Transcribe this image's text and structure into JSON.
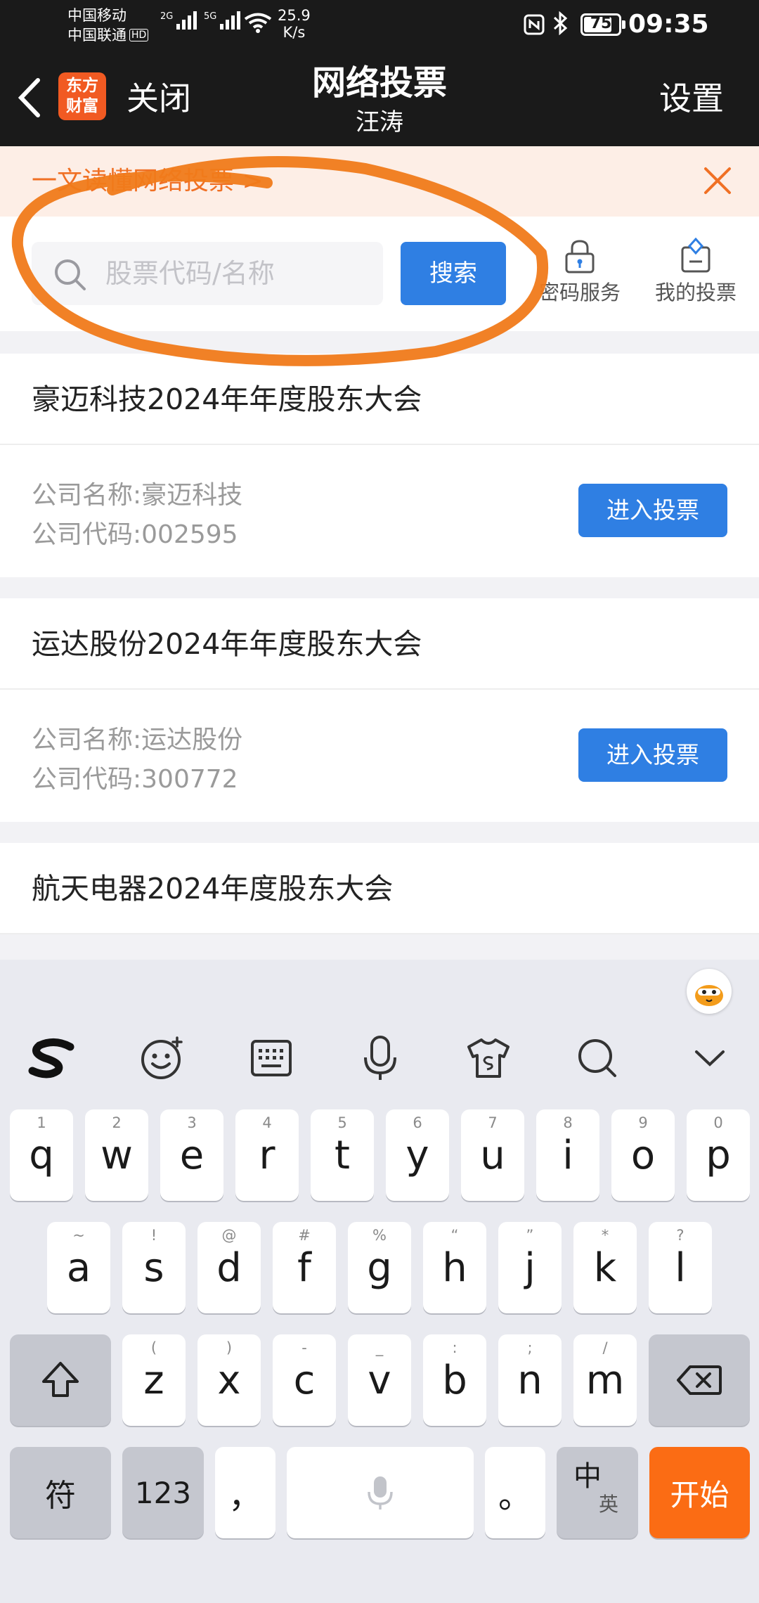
{
  "status_bar": {
    "carrier_1": "中国移动",
    "carrier_2": "中国联通",
    "hd_badge": "HD",
    "signal_1_label": "2G",
    "signal_2_label": "5G",
    "net_speed_value": "25.9",
    "net_speed_unit": "K/s",
    "battery_level": "75",
    "time": "09:35",
    "icons": [
      "nfc-icon",
      "bluetooth-icon",
      "wifi-icon",
      "battery-icon"
    ]
  },
  "header": {
    "back_icon": "chevron-left-icon",
    "app_logo_line1": "东方",
    "app_logo_line2": "财富",
    "close_label": "关闭",
    "title": "网络投票",
    "subtitle": "汪涛",
    "settings_label": "设置"
  },
  "banner": {
    "text": "一文读懂网络投票 >"
  },
  "search": {
    "placeholder": "股票代码/名称",
    "value": "",
    "button_label": "搜索"
  },
  "tools": [
    {
      "label": "密码服务",
      "icon": "lock-icon"
    },
    {
      "label": "我的投票",
      "icon": "my-vote-icon"
    }
  ],
  "votes": [
    {
      "title": "豪迈科技2024年年度股东大会",
      "company_name": "公司名称:豪迈科技",
      "company_code": "公司代码:002595",
      "button_label": "进入投票"
    },
    {
      "title": "运达股份2024年年度股东大会",
      "company_name": "公司名称:运达股份",
      "company_code": "公司代码:300772",
      "button_label": "进入投票"
    },
    {
      "title": "航天电器2024年度股东大会"
    }
  ],
  "keyboard": {
    "toolbar_icons": [
      "sogou-logo-icon",
      "emoji-icon",
      "keyboard-icon",
      "microphone-icon",
      "skin-icon",
      "search-icon",
      "collapse-icon"
    ],
    "row1": [
      {
        "hint": "1",
        "key": "q"
      },
      {
        "hint": "2",
        "key": "w"
      },
      {
        "hint": "3",
        "key": "e"
      },
      {
        "hint": "4",
        "key": "r"
      },
      {
        "hint": "5",
        "key": "t"
      },
      {
        "hint": "6",
        "key": "y"
      },
      {
        "hint": "7",
        "key": "u"
      },
      {
        "hint": "8",
        "key": "i"
      },
      {
        "hint": "9",
        "key": "o"
      },
      {
        "hint": "0",
        "key": "p"
      }
    ],
    "row2": [
      {
        "hint": "~",
        "key": "a"
      },
      {
        "hint": "!",
        "key": "s"
      },
      {
        "hint": "@",
        "key": "d"
      },
      {
        "hint": "#",
        "key": "f"
      },
      {
        "hint": "%",
        "key": "g"
      },
      {
        "hint": "“",
        "key": "h"
      },
      {
        "hint": "”",
        "key": "j"
      },
      {
        "hint": "*",
        "key": "k"
      },
      {
        "hint": "?",
        "key": "l"
      }
    ],
    "row3": [
      {
        "hint": "(",
        "key": "z"
      },
      {
        "hint": ")",
        "key": "x"
      },
      {
        "hint": "-",
        "key": "c"
      },
      {
        "hint": "_",
        "key": "v"
      },
      {
        "hint": ":",
        "key": "b"
      },
      {
        "hint": ";",
        "key": "n"
      },
      {
        "hint": "/",
        "key": "m"
      }
    ],
    "symbol_key": "符",
    "number_key": "123",
    "comma_key": "，",
    "period_key": "。",
    "lang_key_main": "中",
    "lang_key_sub": "英",
    "enter_key": "开始",
    "accent_color": "#fb6c14",
    "button_color": "#2f7fe3"
  }
}
